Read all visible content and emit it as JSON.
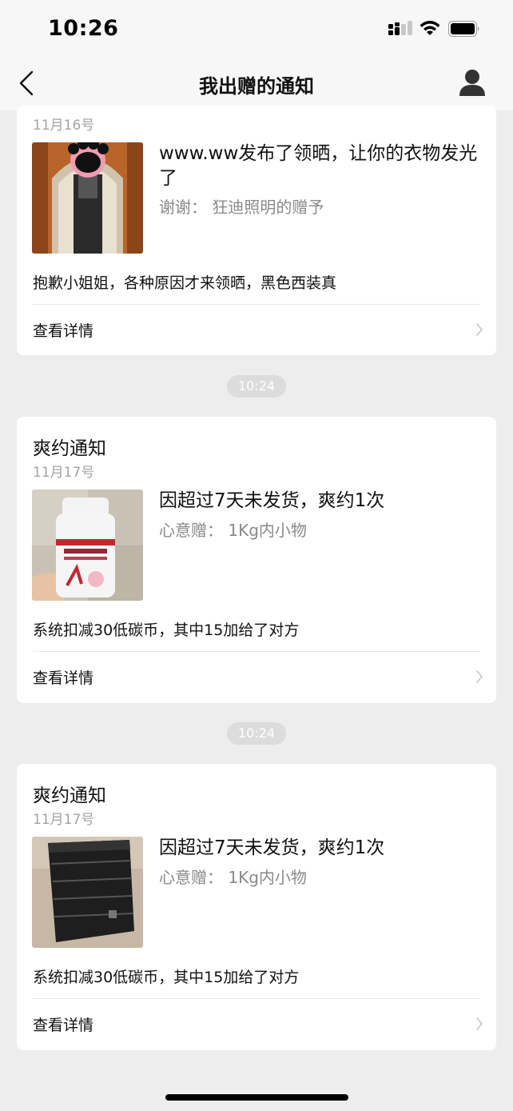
{
  "status_bar": {
    "time": "10:26"
  },
  "nav": {
    "title": "我出赠的通知"
  },
  "cards": [
    {
      "date": "11月16号",
      "main_text": "www.ww发布了领晒，让你的衣物发光了",
      "sub_text": "谢谢：  狂迪照明的赠予",
      "body_text": "抱歉小姐姐，各种原因才来领晒，黑色西装真",
      "details_label": "查看详情"
    },
    {
      "title": "爽约通知",
      "date": "11月17号",
      "main_text": "因超过7天未发货，爽约1次",
      "sub_text": "心意赠：  1Kg内小物",
      "body_text": "系统扣减30低碳币，其中15加给了对方",
      "details_label": "查看详情"
    },
    {
      "title": "爽约通知",
      "date": "11月17号",
      "main_text": "因超过7天未发货，爽约1次",
      "sub_text": "心意赠：  1Kg内小物",
      "body_text": "系统扣减30低碳币，其中15加给了对方",
      "details_label": "查看详情"
    }
  ],
  "timestamps": [
    "10:24",
    "10:24"
  ],
  "icons": {
    "back": "chevron-left-icon",
    "profile": "person-icon",
    "details": "chevron-right-icon"
  }
}
